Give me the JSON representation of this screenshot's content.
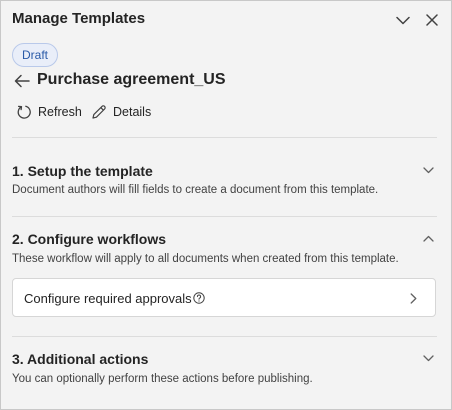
{
  "panel": {
    "title": "Manage Templates",
    "collapse_icon": "chevron-down-icon",
    "close_icon": "close-icon"
  },
  "template": {
    "status_badge": "Draft",
    "name": "Purchase agreement_US",
    "back_icon": "arrow-left-icon"
  },
  "actions": {
    "refresh_label": "Refresh",
    "details_label": "Details"
  },
  "sections": [
    {
      "title": "1. Setup the template",
      "description": "Document authors will fill fields to create a document from this template.",
      "expanded": false
    },
    {
      "title": "2. Configure workflows",
      "description": "These workflow will apply to all documents when created from this template.",
      "expanded": true,
      "items": [
        {
          "label": "Configure required approvals"
        }
      ]
    },
    {
      "title": "3. Additional actions",
      "description": "You can optionally perform these actions before publishing.",
      "expanded": false
    }
  ],
  "colors": {
    "panel_bg": "#f3f3f3",
    "badge_bg": "#e9eef9",
    "badge_text": "#2a5aa8",
    "card_bg": "#ffffff"
  }
}
